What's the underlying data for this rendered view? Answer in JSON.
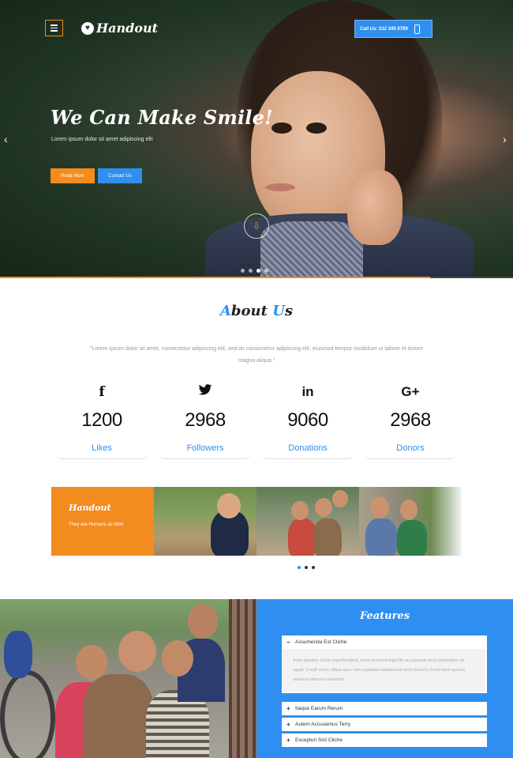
{
  "header": {
    "logo_text": "Handout",
    "call_text": "Call Us: 012 345 6789"
  },
  "hero": {
    "title": "We Can Make Smile!",
    "subtitle": "Lorem ipsum dolor sit amet adipiscing elit",
    "btn_primary": "Read More",
    "btn_secondary": "Contact Us",
    "slides": 4,
    "active_slide": 3
  },
  "about": {
    "title_first": "A",
    "title_rest_1": "bout ",
    "title_second": "U",
    "title_rest_2": "s",
    "text": "\"Lorem ipsum dolor sit amet, consectetur adipiscing elit, sed do consectetur adipiscing elit, eiusmod tempor incididunt ut labore et dolore magna aliqua.\"",
    "stats": [
      {
        "icon": "facebook-icon",
        "glyph": "f",
        "value": "1200",
        "label": "Likes"
      },
      {
        "icon": "twitter-icon",
        "glyph": "🐦",
        "value": "2968",
        "label": "Followers"
      },
      {
        "icon": "linkedin-icon",
        "glyph": "in",
        "value": "9060",
        "label": "Donations"
      },
      {
        "icon": "google-plus-icon",
        "glyph": "G+",
        "value": "2968",
        "label": "Donors"
      }
    ]
  },
  "gallery": {
    "card_title": "Handout",
    "card_subtitle": "They are Humans as Well"
  },
  "features": {
    "title": "Features",
    "items": [
      {
        "title": "Assumenda Est Cliche",
        "expanded": true,
        "body": "Anim pariatur cliche reprehenderit, enim eiusmod high life accusamus terry richardson ad squid. 3 wolf moon officia aute, non cupidatat skateboard dolor brunch. Food truck quinoa nesciunt laborum eiusmod."
      },
      {
        "title": "Itaque Earum Rerum",
        "expanded": false
      },
      {
        "title": "Autem Accusamus Terry",
        "expanded": false
      },
      {
        "title": "Excepturi Sint Cliche",
        "expanded": false
      }
    ]
  },
  "colors": {
    "accent_orange": "#f28c1e",
    "accent_blue": "#2f8ff0"
  }
}
